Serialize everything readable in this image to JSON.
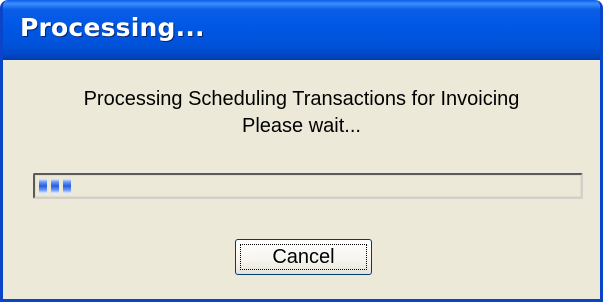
{
  "window": {
    "title": "Processing..."
  },
  "message": {
    "line1": "Processing Scheduling Transactions for Invoicing",
    "line2": "Please wait..."
  },
  "progress": {
    "value_fraction": 0.06,
    "segments_filled": 3,
    "fill_color": "#2a5cd9"
  },
  "buttons": {
    "cancel_label": "Cancel"
  },
  "colors": {
    "titlebar": "#0058e6",
    "dialog_background": "#ece9d8",
    "title_text": "#ffffff"
  }
}
